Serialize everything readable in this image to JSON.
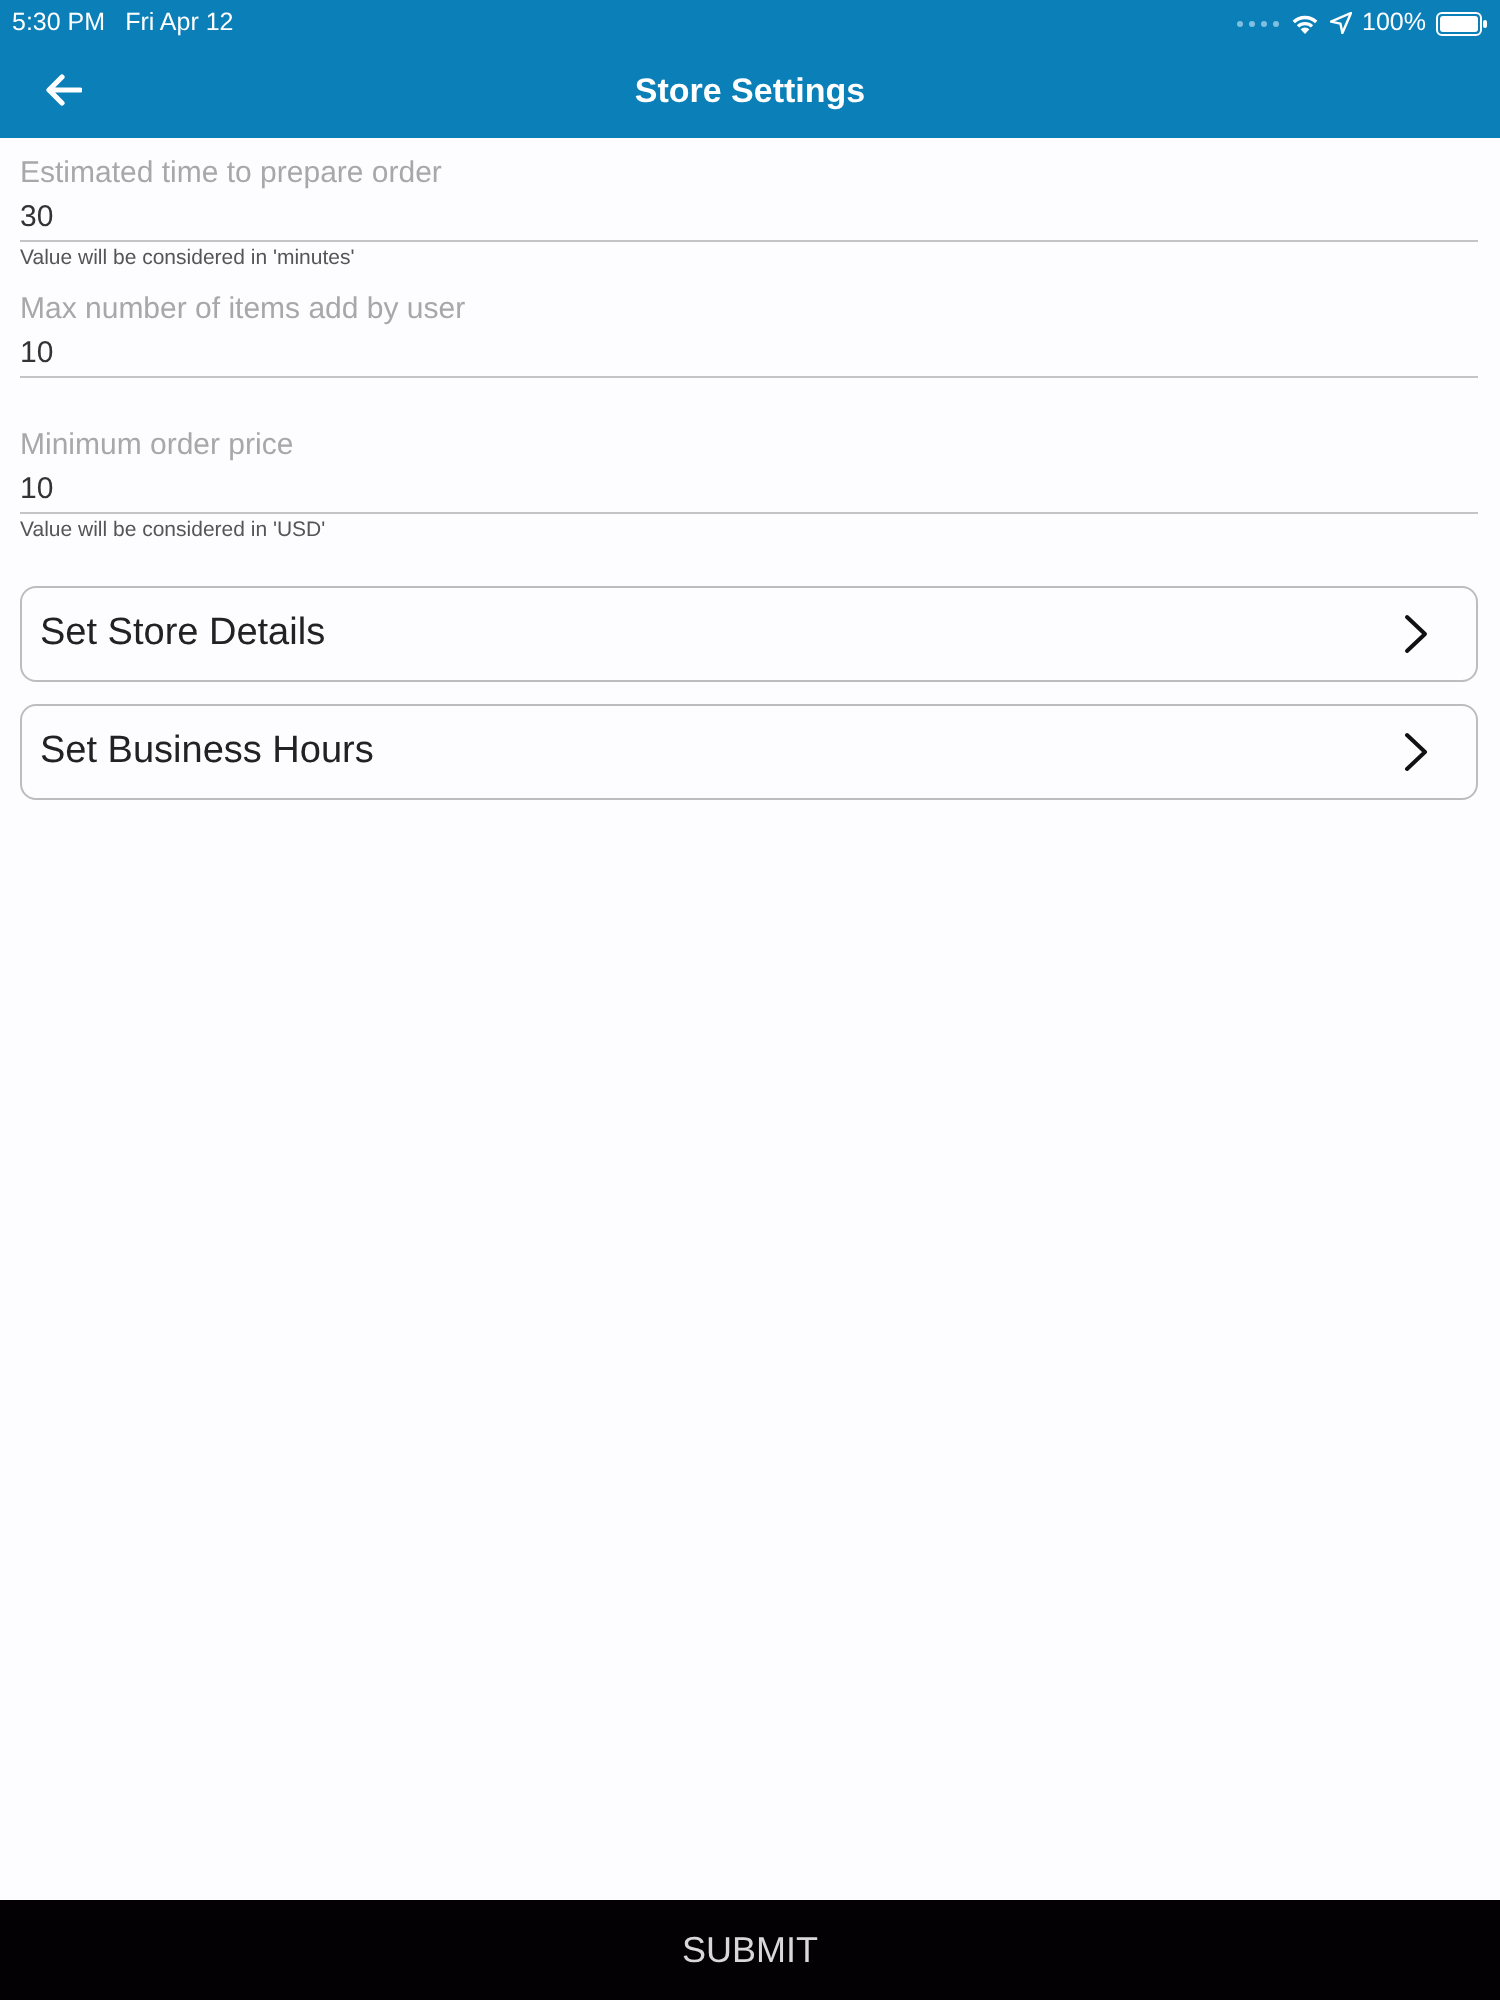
{
  "status_bar": {
    "time": "5:30 PM",
    "date": "Fri Apr 12",
    "battery": "100%"
  },
  "nav_bar": {
    "title": "Store Settings"
  },
  "fields": [
    {
      "label": "Estimated time to prepare order",
      "value": "30",
      "hint": "Value will be considered in 'minutes'"
    },
    {
      "label": "Max number of items add by user",
      "value": "10"
    },
    {
      "label": "Minimum order price",
      "value": "10",
      "hint": "Value will be considered in 'USD'"
    }
  ],
  "links": [
    {
      "label": "Set Store Details"
    },
    {
      "label": "Set Business Hours"
    }
  ],
  "submit_button": {
    "label": "SUBMIT"
  }
}
